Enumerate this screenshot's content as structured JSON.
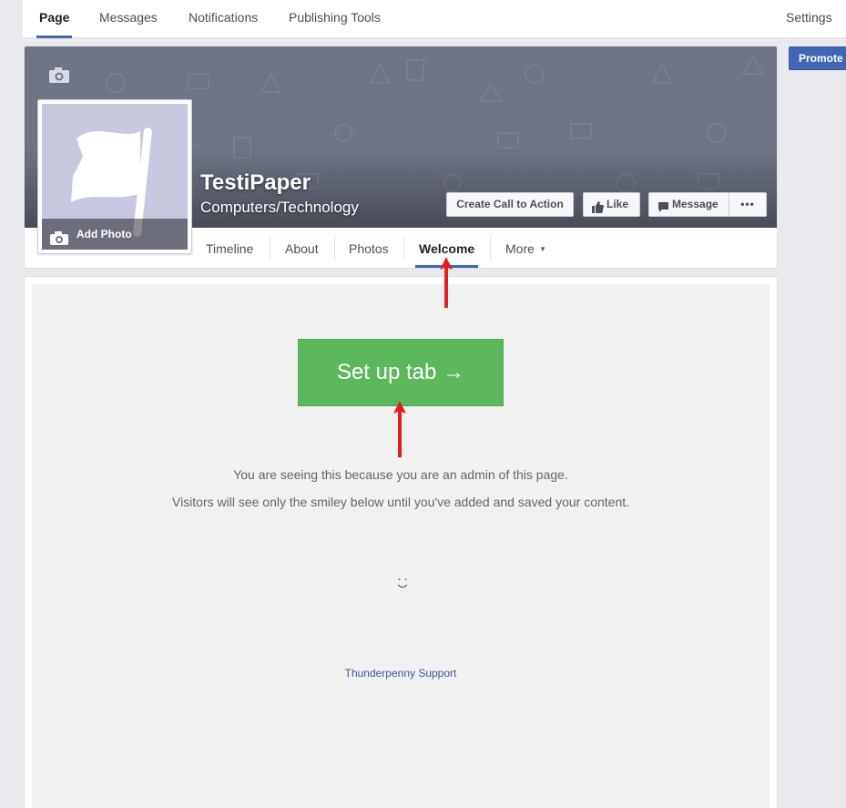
{
  "topbar": {
    "tabs": [
      {
        "label": "Page",
        "active": true
      },
      {
        "label": "Messages"
      },
      {
        "label": "Notifications"
      },
      {
        "label": "Publishing Tools"
      }
    ],
    "settings_label": "Settings"
  },
  "promote_label": "Promote",
  "page": {
    "name": "TestiPaper",
    "category": "Computers/Technology",
    "add_photo_label": "Add Photo"
  },
  "cover_buttons": {
    "cta": "Create Call to Action",
    "like": "Like",
    "message": "Message",
    "more": "•••"
  },
  "page_tabs": [
    {
      "label": "Timeline"
    },
    {
      "label": "About"
    },
    {
      "label": "Photos"
    },
    {
      "label": "Welcome",
      "active": true
    },
    {
      "label": "More"
    }
  ],
  "more_caret": "▾",
  "content": {
    "setup_button": "Set up tab →",
    "admin_notice": "You are seeing this because you are an admin of this page.",
    "visitor_notice": "Visitors will see only the smiley below until you've added and saved your content.",
    "smiley": "◡̈",
    "support_link": "Thunderpenny Support"
  },
  "colors": {
    "brand_blue": "#4267b2",
    "setup_green": "#5cb85c",
    "annotation_red": "#e02020"
  }
}
